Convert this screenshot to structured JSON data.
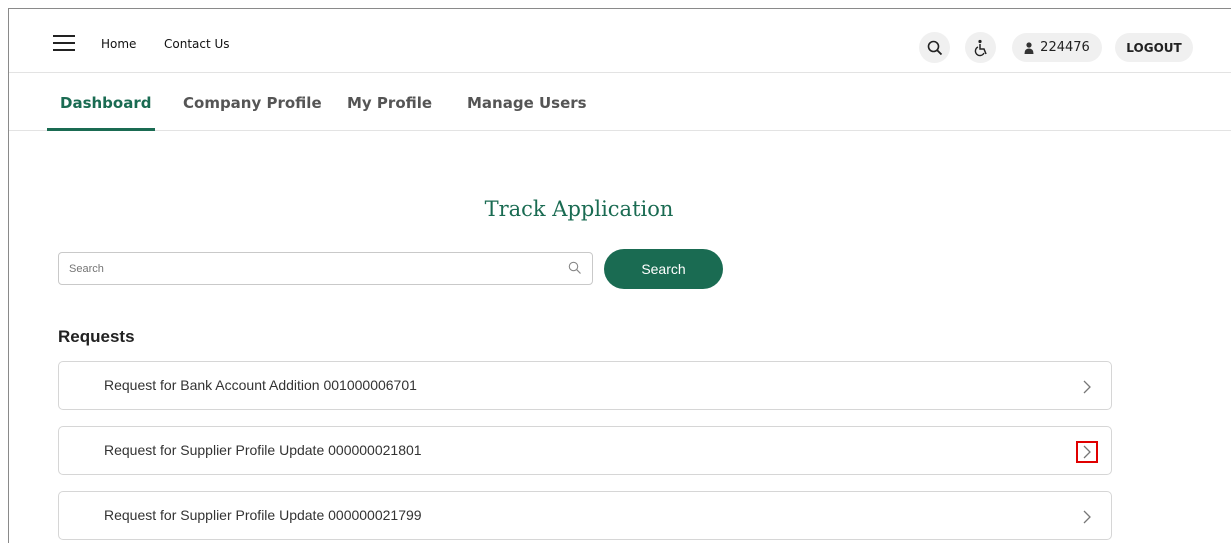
{
  "topbar": {
    "links": {
      "home": "Home",
      "contact": "Contact Us"
    },
    "user_id": "224476",
    "logout_label": "LOGOUT",
    "icons": [
      "menu-icon",
      "search-icon",
      "accessibility-icon",
      "user-icon"
    ]
  },
  "tabs": [
    "Dashboard",
    "Company Profile",
    "My Profile",
    "Manage Users"
  ],
  "active_tab": "Dashboard",
  "main": {
    "title": "Track Application",
    "search": {
      "placeholder": "Search",
      "button_label": "Search"
    },
    "requests_title": "Requests",
    "requests": [
      {
        "label": "Request for Bank Account Addition 001000006701"
      },
      {
        "label": "Request for Supplier Profile Update 000000021801",
        "highlighted": true
      },
      {
        "label": "Request for Supplier Profile Update 000000021799"
      }
    ]
  },
  "colors": {
    "accent": "#1a6b52",
    "highlight": "#e00000"
  }
}
